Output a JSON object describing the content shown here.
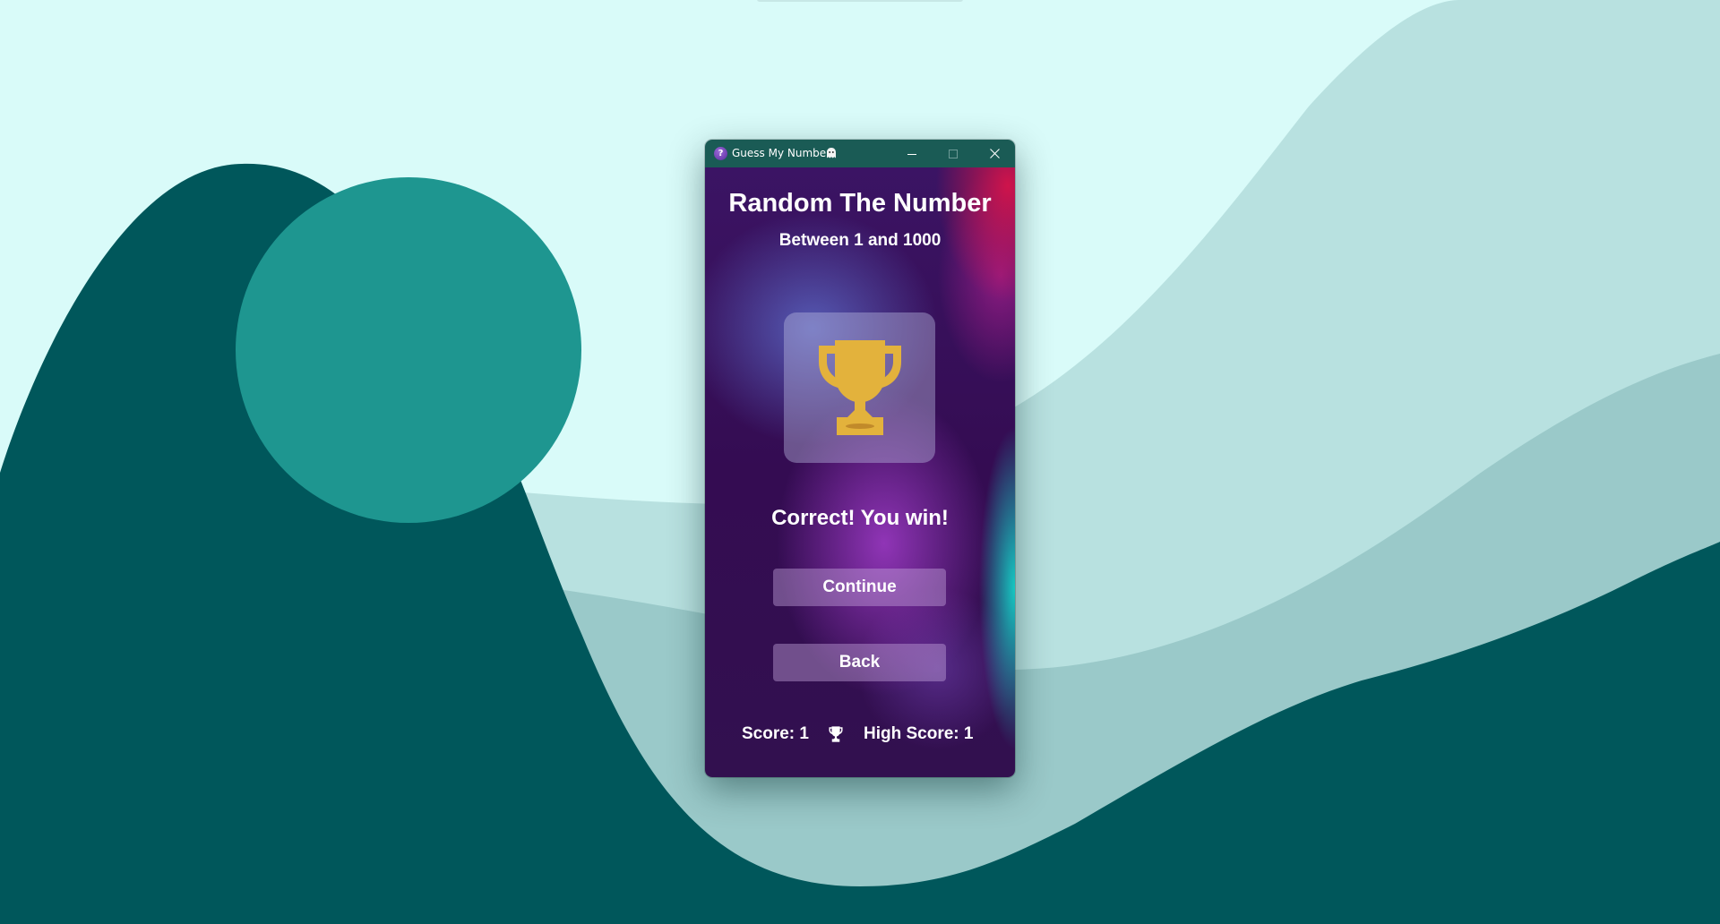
{
  "window": {
    "title": "Guess My Number",
    "app_icon_glyph": "?",
    "title_icon": "ghost-emoji-icon",
    "controls": [
      "minimize-icon",
      "maximize-icon",
      "close-icon"
    ]
  },
  "game": {
    "heading": "Random The Number",
    "range_text": "Between 1 and 1000",
    "result_icon": "trophy-icon",
    "result_message": "Correct! You win!",
    "buttons": {
      "continue_label": "Continue",
      "back_label": "Back"
    },
    "score_text": "Score: 1",
    "score_separator_icon": "trophy-icon",
    "high_score_text": "High Score: 1"
  },
  "colors": {
    "titlebar": "#1a5b55",
    "trophy_gold": "#e3b23c",
    "wallpaper_light": "#d9fbf9",
    "wallpaper_dark": "#00575b",
    "wallpaper_circle": "#1e9690"
  }
}
